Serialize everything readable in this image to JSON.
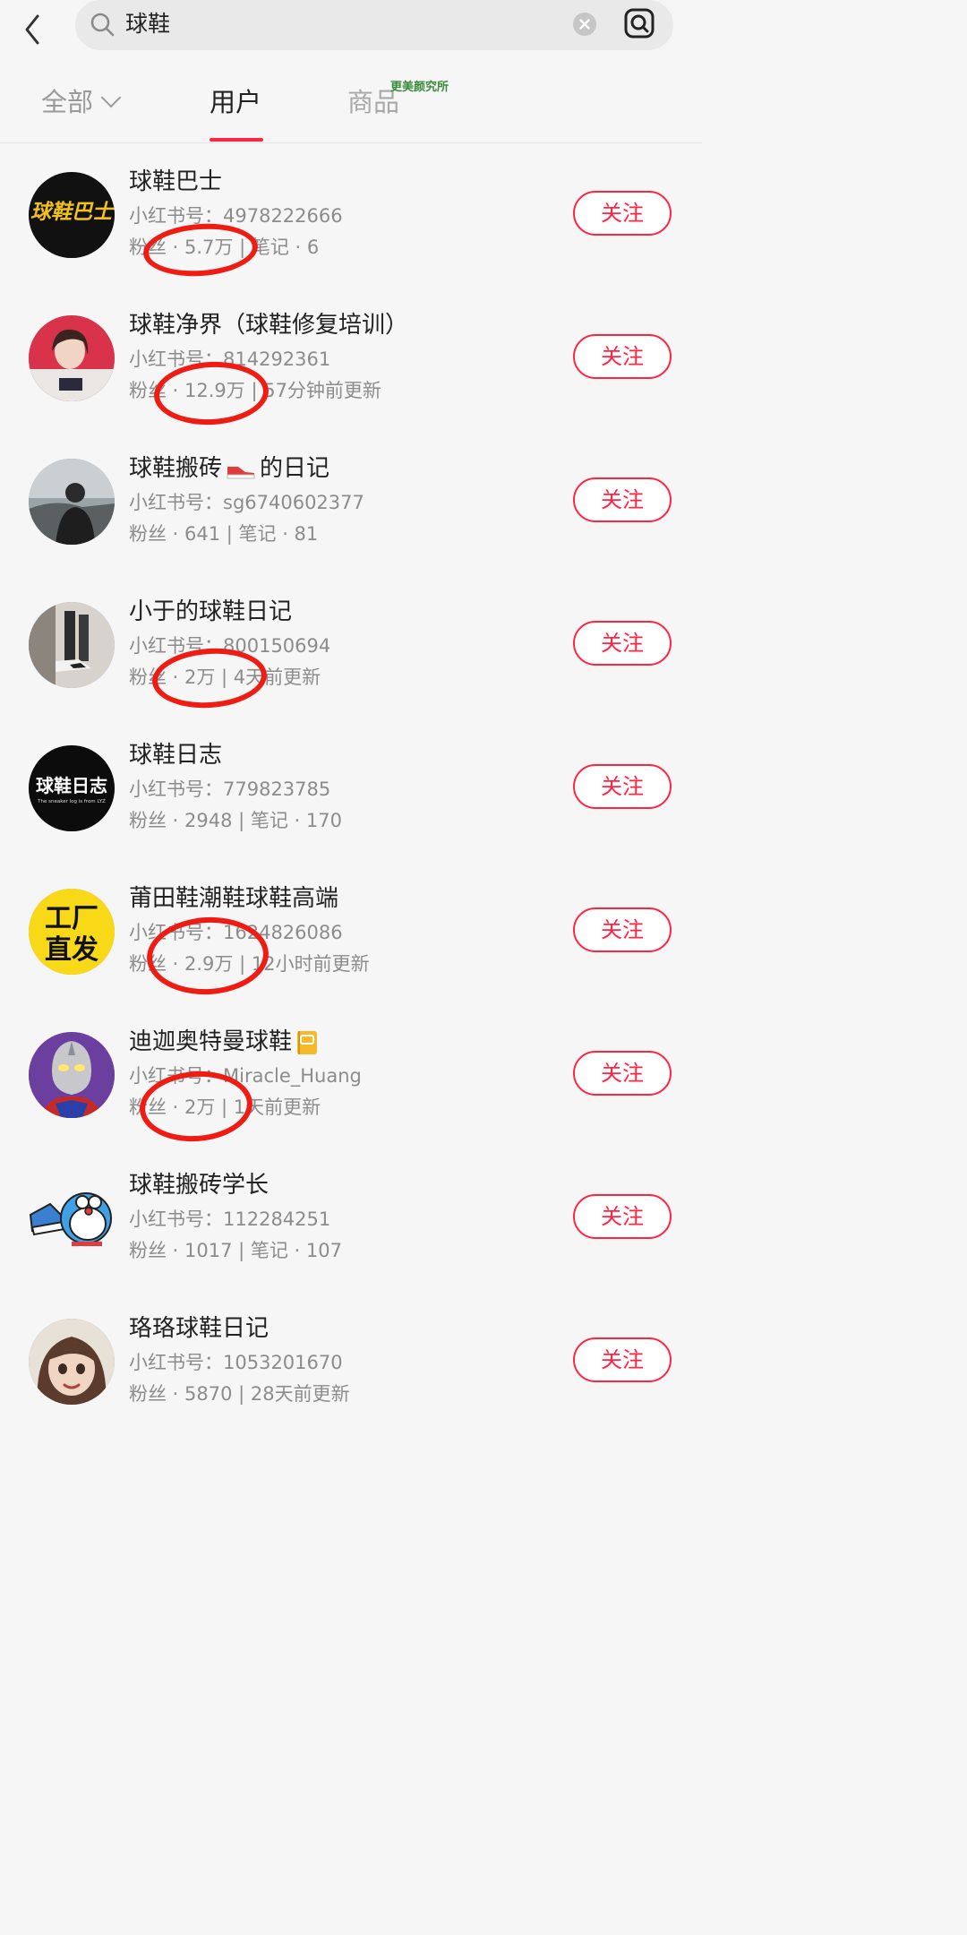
{
  "search": {
    "query": "球鞋"
  },
  "tabs": [
    {
      "label": "全部"
    },
    {
      "label": "用户"
    },
    {
      "label": "商品"
    }
  ],
  "watermark": "更美颜究所",
  "users": [
    {
      "name": "球鞋巴士",
      "id_line": "小红书号：4978222666",
      "stats": "粉丝 · 5.7万 | 笔记 · 6",
      "follow": "关注",
      "avatar_text": "球鞋巴士"
    },
    {
      "name": "球鞋净界（球鞋修复培训）",
      "id_line": "小红书号：814292361",
      "stats": "粉丝 · 12.9万 | 57分钟前更新",
      "follow": "关注"
    },
    {
      "name_before": "球鞋搬砖",
      "name_after": "的日记",
      "id_line": "小红书号：sg6740602377",
      "stats": "粉丝 · 641 | 笔记 · 81",
      "follow": "关注"
    },
    {
      "name": "小于的球鞋日记",
      "id_line": "小红书号：800150694",
      "stats": "粉丝 · 2万 | 4天前更新",
      "follow": "关注"
    },
    {
      "name": "球鞋日志",
      "id_line": "小红书号：779823785",
      "stats": "粉丝 · 2948 | 笔记 · 170",
      "follow": "关注",
      "avatar_text": "球鞋日志",
      "avatar_subtext": "The sneaker log is from LYZ"
    },
    {
      "name": "莆田鞋潮鞋球鞋高端",
      "id_line": "小红书号：1624826086",
      "stats": "粉丝 · 2.9万 | 12小时前更新",
      "follow": "关注",
      "avatar_text_1": "工厂",
      "avatar_text_2": "直发"
    },
    {
      "name": "迪迦奥特曼球鞋",
      "id_line": "小红书号：Miracle_Huang",
      "stats": "粉丝 · 2万 | 1天前更新",
      "follow": "关注"
    },
    {
      "name": "球鞋搬砖学长",
      "id_line": "小红书号：112284251",
      "stats": "粉丝 · 1017 | 笔记 · 107",
      "follow": "关注"
    },
    {
      "name": "珞珞球鞋日记",
      "id_line": "小红书号：1053201670",
      "stats": "粉丝 · 5870 | 28天前更新",
      "follow": "关注"
    }
  ],
  "colors": {
    "accent": "#ff2442",
    "annotation": "#ee1c12"
  }
}
